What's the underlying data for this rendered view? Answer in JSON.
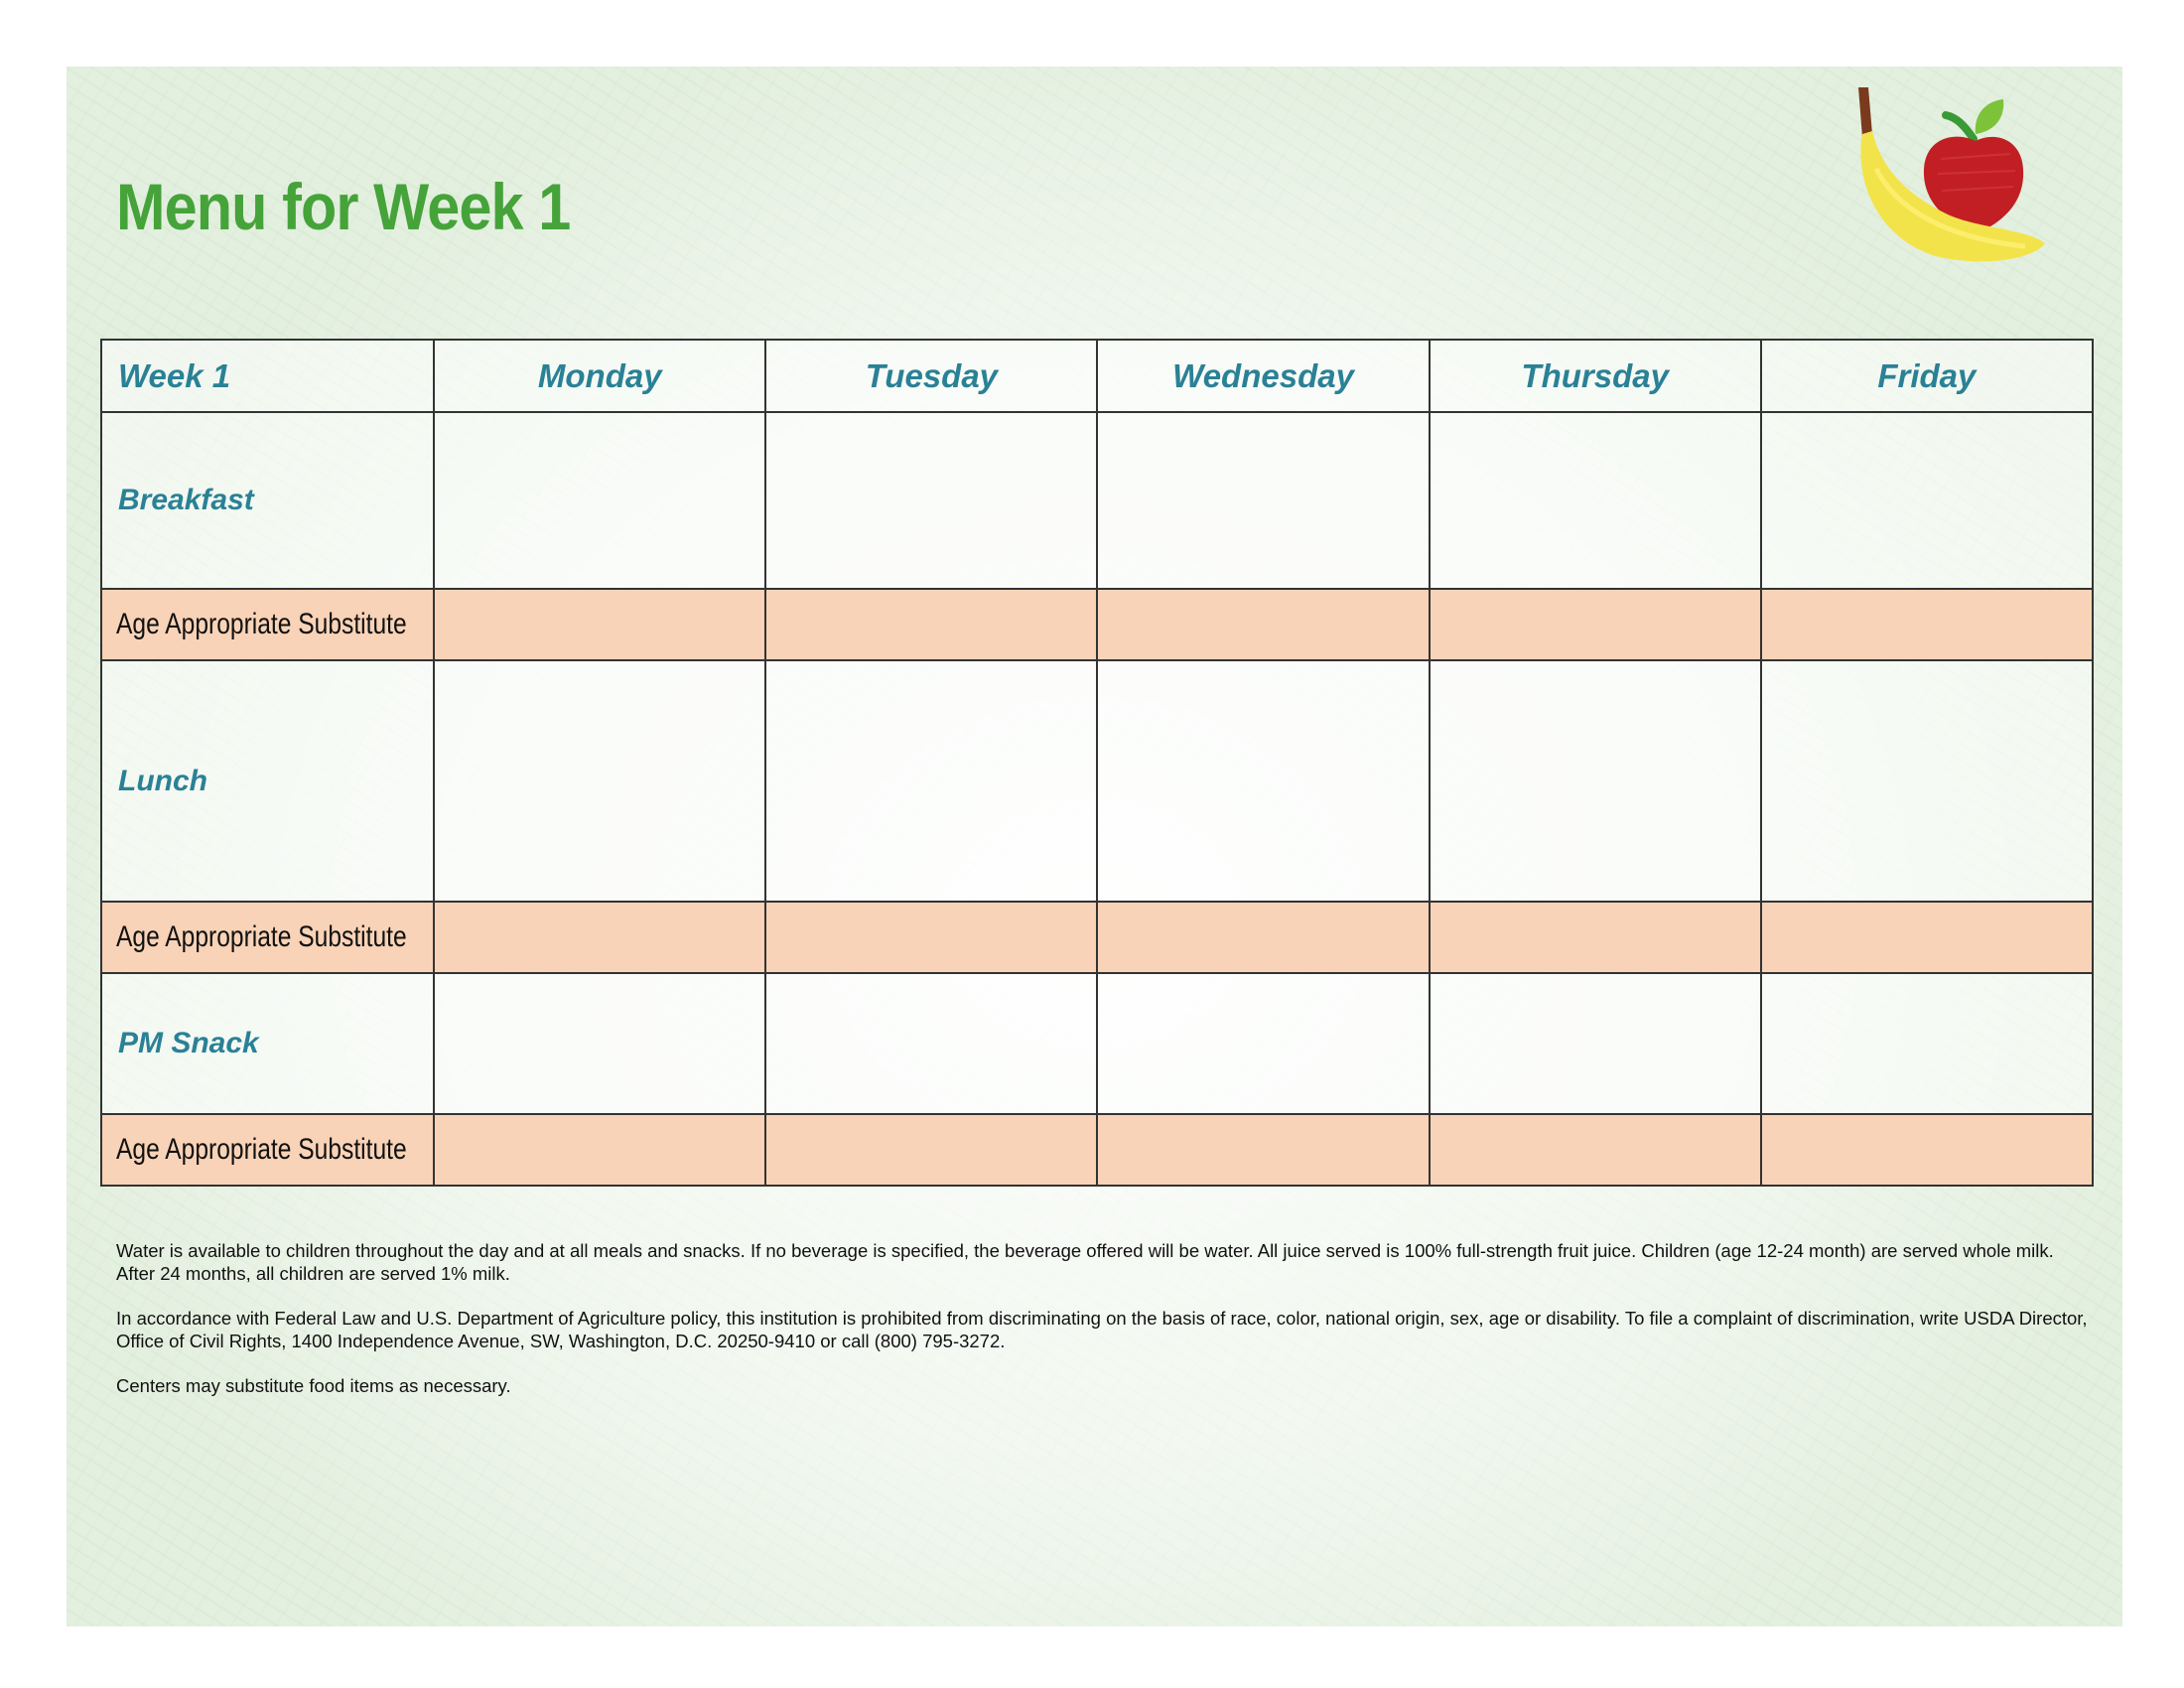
{
  "title": "Menu for Week 1",
  "logo": {
    "icon": "banana-apple-icon"
  },
  "colors": {
    "title_green": "#45a33a",
    "header_teal": "#2a8196",
    "substitute_row_peach": "#f9d3b7",
    "grid_border": "#333333"
  },
  "table": {
    "corner_label": "Week 1",
    "days": [
      "Monday",
      "Tuesday",
      "Wednesday",
      "Thursday",
      "Friday"
    ],
    "rows": [
      {
        "label": "Breakfast",
        "type": "meal",
        "cells": [
          "",
          "",
          "",
          "",
          ""
        ]
      },
      {
        "label": "Age Appropriate Substitute",
        "type": "substitute",
        "cells": [
          "",
          "",
          "",
          "",
          ""
        ]
      },
      {
        "label": "Lunch",
        "type": "meal",
        "cells": [
          "",
          "",
          "",
          "",
          ""
        ]
      },
      {
        "label": "Age Appropriate Substitute",
        "type": "substitute",
        "cells": [
          "",
          "",
          "",
          "",
          ""
        ]
      },
      {
        "label": "PM Snack",
        "type": "meal",
        "cells": [
          "",
          "",
          "",
          "",
          ""
        ]
      },
      {
        "label": "Age Appropriate Substitute",
        "type": "substitute",
        "cells": [
          "",
          "",
          "",
          "",
          ""
        ]
      }
    ]
  },
  "notes": [
    "Water is available to children throughout the day and at all meals and snacks. If no beverage is specified, the beverage offered will be water. All juice served is 100% full-strength fruit juice. Children (age 12-24 month) are served whole milk. After 24 months, all children are served 1% milk.",
    "In accordance with Federal Law and U.S. Department of Agriculture policy, this institution is prohibited from discriminating on the basis of race, color, national origin, sex, age or disability. To file a complaint of discrimination, write USDA Director, Office of Civil Rights, 1400 Independence Avenue, SW, Washington, D.C. 20250-9410 or call (800) 795-3272.",
    "Centers may substitute food items as necessary."
  ]
}
